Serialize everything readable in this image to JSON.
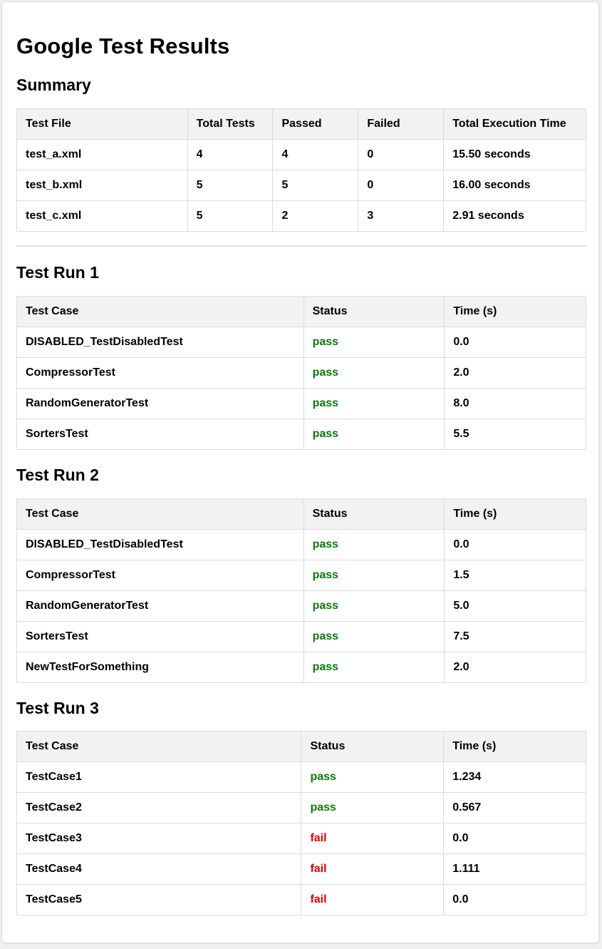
{
  "title": "Google Test Results",
  "summary": {
    "heading": "Summary",
    "columns": [
      "Test File",
      "Total Tests",
      "Passed",
      "Failed",
      "Total Execution Time"
    ],
    "rows": [
      [
        "test_a.xml",
        "4",
        "4",
        "0",
        "15.50 seconds"
      ],
      [
        "test_b.xml",
        "5",
        "5",
        "0",
        "16.00 seconds"
      ],
      [
        "test_c.xml",
        "5",
        "2",
        "3",
        "2.91 seconds"
      ]
    ]
  },
  "runs": [
    {
      "heading": "Test Run 1",
      "columns": [
        "Test Case",
        "Status",
        "Time (s)"
      ],
      "rows": [
        [
          "DISABLED_TestDisabledTest",
          "pass",
          "0.0"
        ],
        [
          "CompressorTest",
          "pass",
          "2.0"
        ],
        [
          "RandomGeneratorTest",
          "pass",
          "8.0"
        ],
        [
          "SortersTest",
          "pass",
          "5.5"
        ]
      ]
    },
    {
      "heading": "Test Run 2",
      "columns": [
        "Test Case",
        "Status",
        "Time (s)"
      ],
      "rows": [
        [
          "DISABLED_TestDisabledTest",
          "pass",
          "0.0"
        ],
        [
          "CompressorTest",
          "pass",
          "1.5"
        ],
        [
          "RandomGeneratorTest",
          "pass",
          "5.0"
        ],
        [
          "SortersTest",
          "pass",
          "7.5"
        ],
        [
          "NewTestForSomething",
          "pass",
          "2.0"
        ]
      ]
    },
    {
      "heading": "Test Run 3",
      "columns": [
        "Test Case",
        "Status",
        "Time (s)"
      ],
      "rows": [
        [
          "TestCase1",
          "pass",
          "1.234"
        ],
        [
          "TestCase2",
          "pass",
          "0.567"
        ],
        [
          "TestCase3",
          "fail",
          "0.0"
        ],
        [
          "TestCase4",
          "fail",
          "1.111"
        ],
        [
          "TestCase5",
          "fail",
          "0.0"
        ]
      ]
    }
  ],
  "colors": {
    "pass": "#0a7a0a",
    "fail": "#e00000",
    "header_bg": "#f2f2f2"
  }
}
